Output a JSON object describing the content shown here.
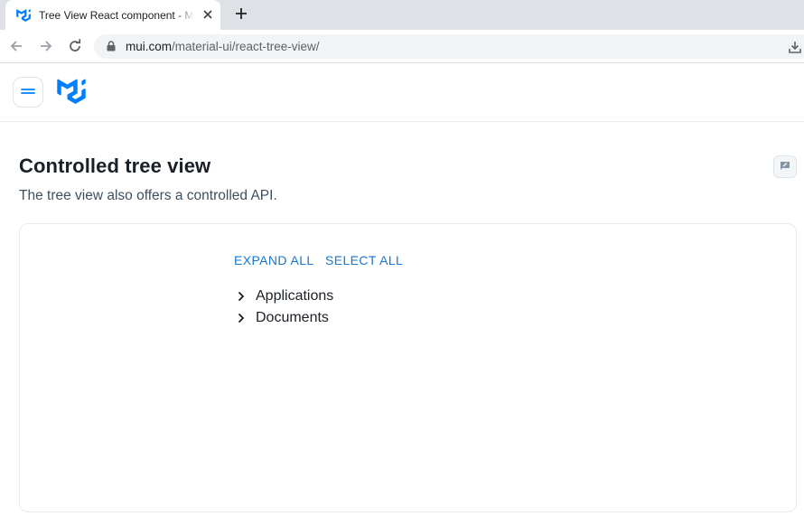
{
  "browser": {
    "tab_title": "Tree View React component - MUI",
    "url_host": "mui.com",
    "url_path": "/material-ui/react-tree-view/"
  },
  "header": {
    "menu_icon": "menu-icon",
    "logo_icon": "mui-logo-icon"
  },
  "section": {
    "title": "Controlled tree view",
    "description": "The tree view also offers a controlled API."
  },
  "demo": {
    "expand_all_label": "EXPAND ALL",
    "select_all_label": "SELECT ALL",
    "tree_items": [
      {
        "label": "Applications",
        "icon": "chevron-right-icon"
      },
      {
        "label": "Documents",
        "icon": "chevron-right-icon"
      }
    ]
  },
  "colors": {
    "accent": "#1976d2",
    "logo": "#007fff",
    "text": "#1a2027"
  }
}
